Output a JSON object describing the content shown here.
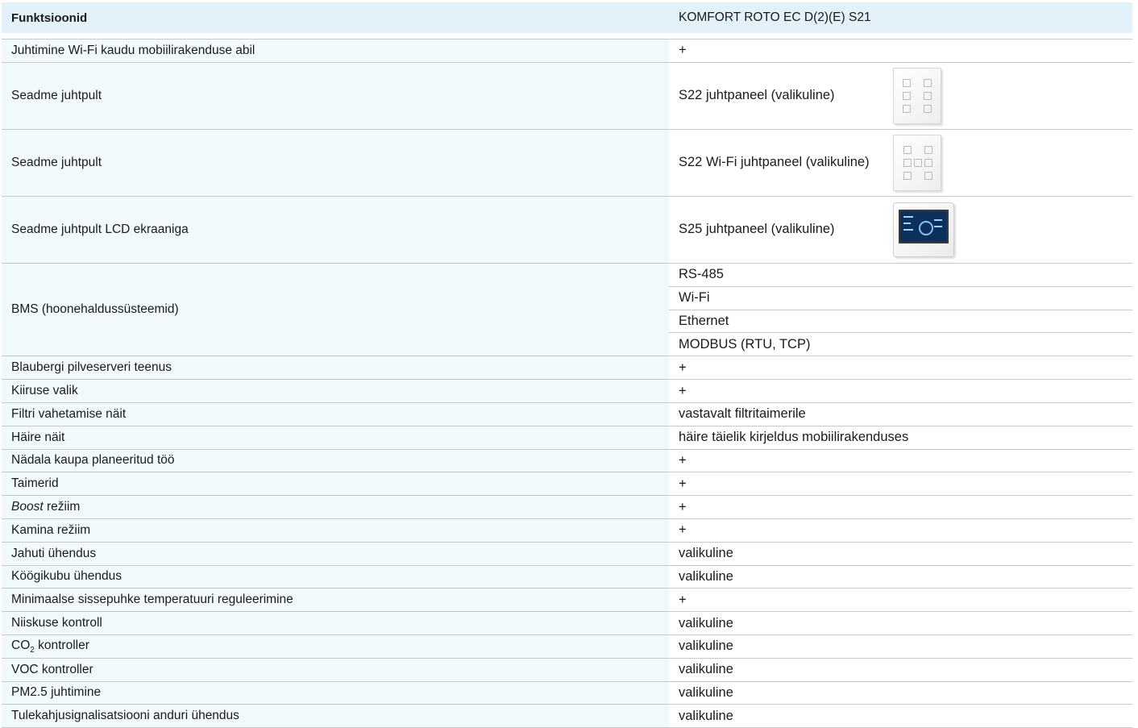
{
  "header": {
    "col1": "Funktsioonid",
    "col2": "KOMFORT ROTO EC D(2)(E) S21"
  },
  "rows_top": [
    {
      "label": "Juhtimine Wi-Fi kaudu mobiilirakenduse abil",
      "value": "+"
    }
  ],
  "panels": [
    {
      "label": "Seadme juhtpult",
      "value": "S22 juhtpaneel (valikuline)",
      "icon": "s22-panel-icon"
    },
    {
      "label": "Seadme juhtpult",
      "value": "S22 Wi-Fi juhtpaneel (valikuline)",
      "icon": "s22-wifi-panel-icon"
    },
    {
      "label": "Seadme juhtpult LCD ekraaniga",
      "value": "S25 juhtpaneel (valikuline)",
      "icon": "s25-lcd-panel-icon"
    }
  ],
  "bms": {
    "label": "BMS (hoonehaldussüsteemid)",
    "values": [
      "RS-485",
      "Wi-Fi",
      "Ethernet",
      "MODBUS (RTU, TCP)"
    ]
  },
  "rows": [
    {
      "label": "Blaubergi pilveserveri teenus",
      "value": "+"
    },
    {
      "label": "Kiiruse valik",
      "value": "+"
    },
    {
      "label": "Filtri vahetamise näit",
      "value": "vastavalt filtritaimerile"
    },
    {
      "label": "Häire näit",
      "value": "häire täielik kirjeldus mobiilirakenduses"
    },
    {
      "label": "Nädala kaupa planeeritud töö",
      "value": "+"
    },
    {
      "label": "Taimerid",
      "value": "+"
    },
    {
      "label_italic": "Boost",
      "label_rest": " režiim",
      "value": "+"
    },
    {
      "label": "Kamina režiim",
      "value": "+"
    },
    {
      "label": "Jahuti ühendus",
      "value": "valikuline"
    },
    {
      "label": "Köögikubu ühendus",
      "value": "valikuline"
    },
    {
      "label": "Minimaalse sissepuhke temperatuuri reguleerimine",
      "value": "+"
    },
    {
      "label": "Niiskuse kontroll",
      "value": "valikuline"
    },
    {
      "label_pre": "CO",
      "label_sub": "2",
      "label_rest": " kontroller",
      "value": "valikuline"
    },
    {
      "label": "VOC kontroller",
      "value": "valikuline"
    },
    {
      "label": "PM2.5 juhtimine",
      "value": "valikuline"
    },
    {
      "label": "Tulekahjusignalisatsiooni anduri ühendus",
      "value": "valikuline"
    }
  ]
}
